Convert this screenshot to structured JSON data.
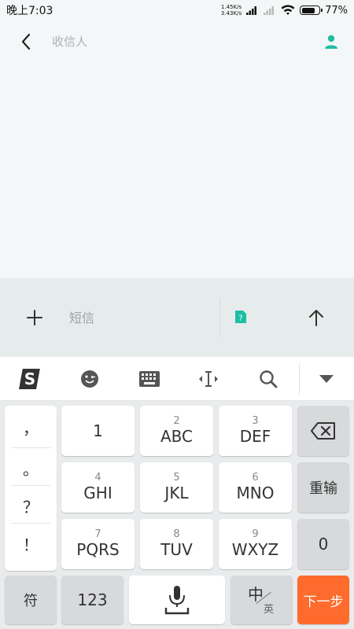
{
  "status_bar": {
    "time": "晚上7:03",
    "upload_speed": "1.45K/s",
    "download_speed": "3.43K/s",
    "battery_percent": "77%",
    "battery_level": 0.77
  },
  "header": {
    "back_icon": "chevron-left-icon",
    "recipient_placeholder": "收信人",
    "contact_icon": "person-icon"
  },
  "compose": {
    "message_placeholder": "短信",
    "attach_icon": "plus-icon",
    "sim_icon": "sim-card-icon",
    "send_icon": "arrow-up-icon"
  },
  "keyboard_toolbar": {
    "items": [
      "sogou-logo-icon",
      "emoji-icon",
      "keyboard-icon",
      "cursor-icon",
      "search-icon",
      "collapse-keyboard-icon"
    ]
  },
  "keyboard": {
    "punctuation": [
      "，",
      "。",
      "？",
      "！"
    ],
    "keys": [
      {
        "num": "",
        "letters": "1"
      },
      {
        "num": "2",
        "letters": "ABC"
      },
      {
        "num": "3",
        "letters": "DEF"
      },
      {
        "num": "4",
        "letters": "GHI"
      },
      {
        "num": "5",
        "letters": "JKL"
      },
      {
        "num": "6",
        "letters": "MNO"
      },
      {
        "num": "7",
        "letters": "PQRS"
      },
      {
        "num": "8",
        "letters": "TUV"
      },
      {
        "num": "9",
        "letters": "WXYZ"
      }
    ],
    "retype": "重输",
    "zero": "0",
    "symbols": "符",
    "numbers": "123",
    "chinese": "中",
    "english": "英",
    "next_step": "下一步"
  },
  "colors": {
    "accent": "#1ebea5",
    "orange": "#fe6b2c",
    "compose_bg": "#e6ecec",
    "page_bg": "#f4f7f7"
  }
}
